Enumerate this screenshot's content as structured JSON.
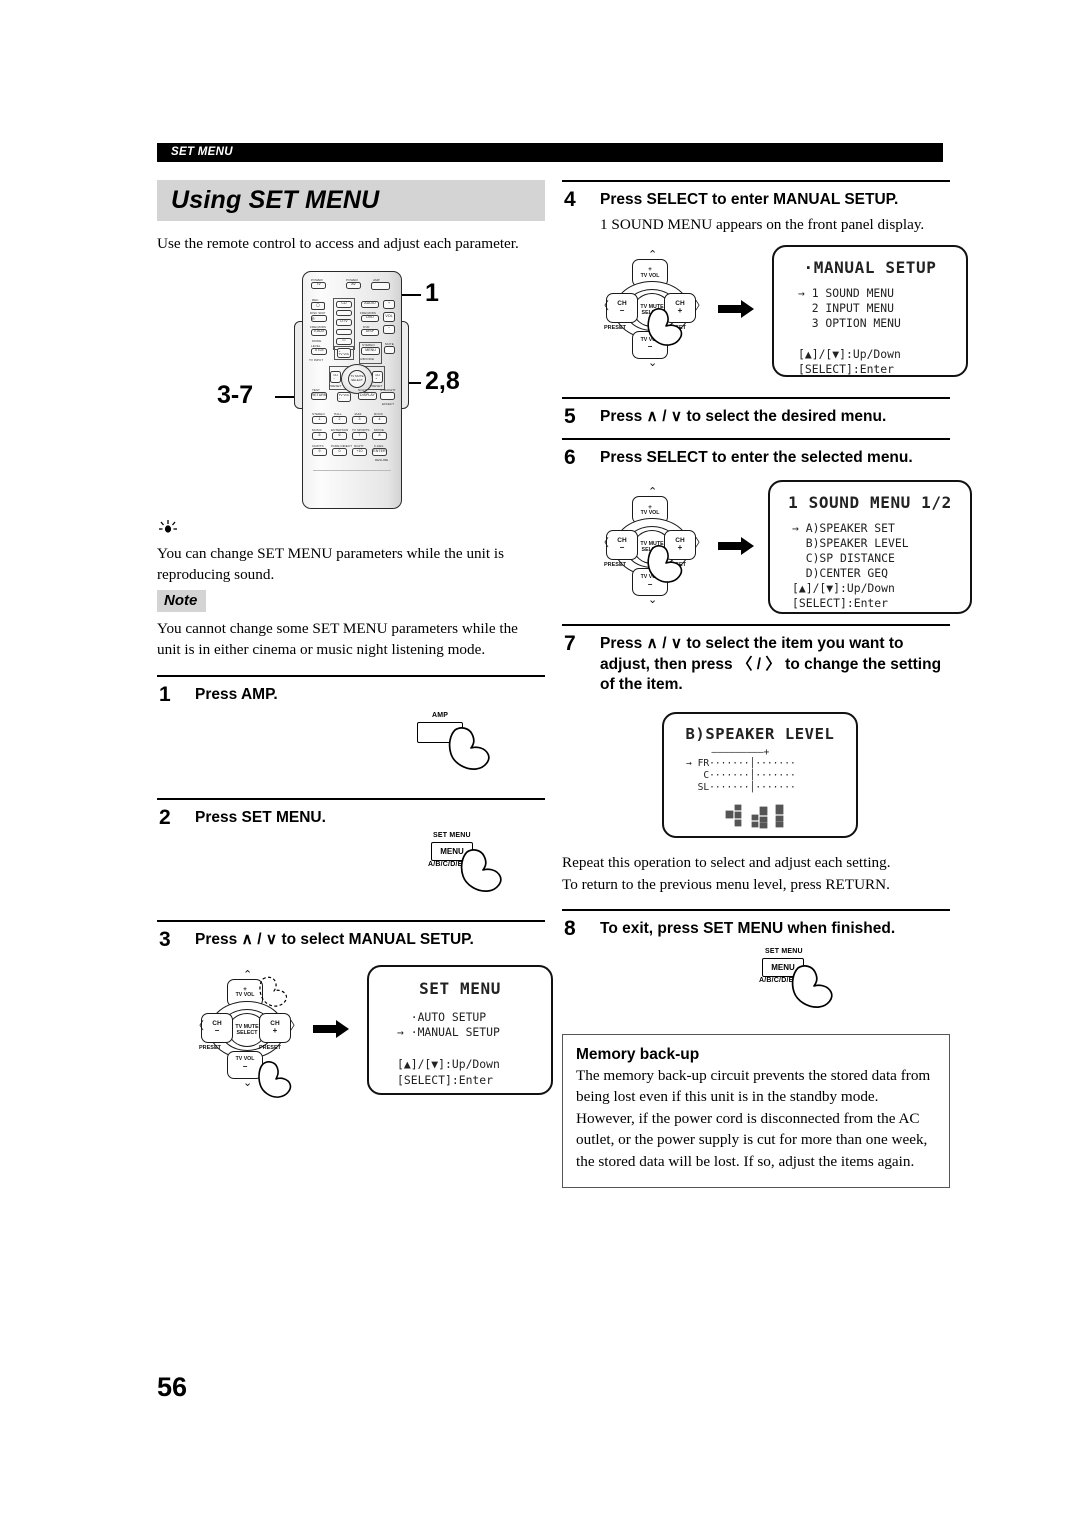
{
  "header": {
    "running_head": "SET MENU"
  },
  "page": {
    "number": "56"
  },
  "title": {
    "text": "Using SET MENU"
  },
  "intro": {
    "text": "Use the remote control to access and adjust each parameter."
  },
  "tip": {
    "icon": "lightbulb-icon",
    "text": "You can change SET MENU parameters while the unit is reproducing sound."
  },
  "note": {
    "label": "Note",
    "text": "You cannot change some SET MENU parameters while the unit is in either cinema or music night listening mode."
  },
  "remote_callouts": [
    {
      "label": "1"
    },
    {
      "label": "2,8"
    },
    {
      "label": "3-7"
    }
  ],
  "remote": {
    "top_labels": {
      "power_tv": "POWER",
      "power_av": "POWER",
      "amp": "AMP"
    },
    "buttons": [
      {
        "label": "TV",
        "cap": "POWER"
      },
      {
        "label": "AV",
        "cap": "POWER"
      },
      {
        "label": "",
        "cap": "AMP"
      },
      {
        "label": "REC",
        "cap": "REC"
      },
      {
        "label": "CD",
        "cap": ""
      },
      {
        "label": "AUDIO",
        "cap": ""
      },
      {
        "label": "DISC SKIP",
        "cap": "DISC SKIP"
      },
      {
        "label": "MD/CD-R",
        "cap": "FREQ/RDS"
      },
      {
        "label": "DTV",
        "cap": ""
      },
      {
        "label": "DVD",
        "cap": "DVR"
      },
      {
        "label": "V-AUX",
        "cap": "MD/CD-R"
      },
      {
        "label": "DISP",
        "cap": ""
      },
      {
        "label": "LEVEL",
        "cap": "MODE"
      },
      {
        "label": "TITLE",
        "cap": "TV VOL"
      },
      {
        "label": "TV INPUT",
        "cap": "TV CH"
      },
      {
        "label": "STEREO",
        "cap": ""
      },
      {
        "label": "MENU",
        "cap": "SET MENU"
      },
      {
        "label": "A/B/C/D/E",
        "cap": ""
      },
      {
        "label": "MUTE",
        "cap": ""
      },
      {
        "label": "VOL",
        "cap": ""
      },
      {
        "label": "TEST",
        "cap": ""
      },
      {
        "label": "RETURN",
        "cap": ""
      },
      {
        "label": "DISPLAY",
        "cap": "NIGHT"
      },
      {
        "label": "STRAIGHT",
        "cap": ""
      },
      {
        "label": "EFFECT",
        "cap": ""
      }
    ],
    "numeric": [
      {
        "cap": "STEREO",
        "label": "1"
      },
      {
        "cap": "HALL",
        "label": "2"
      },
      {
        "cap": "JAZZ",
        "label": "3"
      },
      {
        "cap": "ROCK",
        "label": "4"
      },
      {
        "cap": "MUSIC",
        "label": "5"
      },
      {
        "cap": "ENTERTAIN",
        "label": "6"
      },
      {
        "cap": "TV SPORTS",
        "label": "7"
      },
      {
        "cap": "MOVIE",
        "label": "8"
      },
      {
        "cap": "CD/DTS",
        "label": "9"
      },
      {
        "cap": "PURE DIRECT",
        "label": "0"
      },
      {
        "cap": "NIGHT",
        "label": "+10"
      },
      {
        "cap": "6.1/ES",
        "label": "ENTER"
      }
    ],
    "dpad": {
      "center": "TV MUTE\nSELECT",
      "up": "TV VOL",
      "down": "TV VOL",
      "left": "CH",
      "right": "CH",
      "preset_left": "PRESET",
      "preset_right": "PRESET"
    }
  },
  "steps": [
    {
      "num": "1",
      "head": "Press AMP.",
      "sub": "",
      "illus": {
        "type": "button",
        "cap_top": "AMP",
        "cap_text": "",
        "cap_bottom": ""
      }
    },
    {
      "num": "2",
      "head": "Press SET MENU.",
      "sub": "",
      "illus": {
        "type": "button",
        "cap_top": "SET MENU",
        "cap_text": "MENU",
        "cap_bottom": "A/B/C/D/E"
      }
    },
    {
      "num": "3",
      "head_pre": "Press ",
      "head_keys": "∧ / ∨",
      "head_post": " to select MANUAL SETUP.",
      "head": "Press ∧ / ∨ to select MANUAL SETUP."
    },
    {
      "num": "4",
      "head": "Press SELECT to enter MANUAL SETUP.",
      "sub": "1 SOUND MENU appears on the front panel display."
    },
    {
      "num": "5",
      "head": "Press ∧ / ∨ to select the desired menu."
    },
    {
      "num": "6",
      "head": "Press SELECT to enter the selected menu."
    },
    {
      "num": "7",
      "head": "Press ∧ / ∨ to select the item you want to adjust, then press 〈 / 〉 to change the setting of the item."
    },
    {
      "num": "8",
      "head": "To exit, press SET MENU when finished.",
      "illus": {
        "type": "button",
        "cap_top": "SET MENU",
        "cap_text": "MENU",
        "cap_bottom": "A/B/C/D/E"
      }
    }
  ],
  "displays": {
    "set_menu": {
      "title": "SET MENU",
      "lines": [
        "  ·AUTO SETUP",
        "→ ·MANUAL SETUP",
        "",
        "[▲]/[▼]:Up/Down",
        "[SELECT]:Enter"
      ]
    },
    "manual_setup": {
      "title": "·MANUAL SETUP",
      "lines": [
        "→ 1 SOUND MENU",
        "  2 INPUT MENU",
        "  3 OPTION MENU",
        "",
        "[▲]/[▼]:Up/Down",
        "[SELECT]:Enter"
      ]
    },
    "sound_menu": {
      "title": "1 SOUND MENU 1/2",
      "lines": [
        "→ A)SPEAKER SET",
        "  B)SPEAKER LEVEL",
        "  C)SP DISTANCE",
        "  D)CENTER GEQ",
        "[▲]/[▼]:Up/Down",
        "[SELECT]:Enter"
      ]
    },
    "speaker_level": {
      "title": "B)SPEAKER LEVEL",
      "scale": "  –————————+",
      "rows": [
        {
          "marker": "→",
          "label": "FR",
          "bar": "·······│·······"
        },
        {
          "marker": " ",
          "label": " C",
          "bar": "·······│·······"
        },
        {
          "marker": " ",
          "label": "SL",
          "bar": "·······│·······"
        }
      ],
      "speaker_icons": "speaker-layout-icons"
    }
  },
  "repeat_note": {
    "line1": "Repeat this operation to select and adjust each setting.",
    "line2": "To return to the previous menu level, press RETURN."
  },
  "memory_backup": {
    "heading": "Memory back-up",
    "text": "The memory back-up circuit prevents the stored data from being lost even if this unit is in the standby mode. However, if the power cord is disconnected from the AC outlet, or the power supply is cut for more than one week, the stored data will be lost. If so, adjust the items again."
  },
  "colors": {
    "header_bg": "#000000",
    "title_band": "#d4d4d4",
    "note_tag": "#d4d4d4",
    "text": "#000000"
  }
}
